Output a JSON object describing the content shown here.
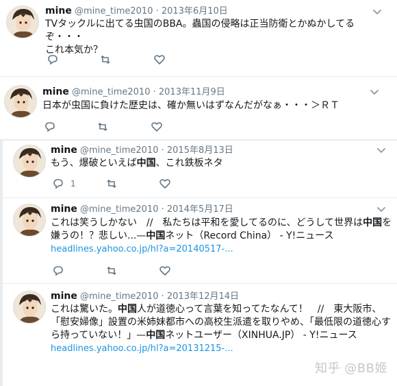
{
  "tweets": [
    {
      "name": "mine",
      "handle": "@mine_time2010",
      "date": "2013年6月10日",
      "text_line1": "TVタックルに出てる虫国のBBA。蟲国の侵略は正当防衛とかぬかしてるぞ・・・",
      "text_line2": "これ本気か？",
      "reply_count": "",
      "retweet_count": "",
      "like_count": ""
    },
    {
      "name": "mine",
      "handle": "@mine_time2010",
      "date": "2013年11月9日",
      "text_line1": "日本が虫国に負けた歴史は、確か無いはずなんだがなぁ・・・＞ＲＴ",
      "reply_count": "",
      "retweet_count": "",
      "like_count": ""
    },
    {
      "name": "mine",
      "handle": "@mine_time2010",
      "date": "2015年8月13日",
      "text_pre": "もう、爆破といえば",
      "text_bold": "中国",
      "text_post": "、これ鉄板ネタ",
      "reply_count": "1",
      "retweet_count": "",
      "like_count": ""
    },
    {
      "name": "mine",
      "handle": "@mine_time2010",
      "date": "2014年5月17日",
      "l1_a": "これは笑うしかない　//　私たちは平和を愛してるのに、どうして世界は",
      "l1_b": "中国",
      "l1_c": "を",
      "l2_a": "嫌うの！？悲しい...—",
      "l2_b": "中国",
      "l2_c": "ネット（Record China） - Y!ニュース",
      "link": "headlines.yahoo.co.jp/hl?a=20140517-...",
      "reply_count": "",
      "retweet_count": "",
      "like_count": ""
    },
    {
      "name": "mine",
      "handle": "@mine_time2010",
      "date": "2013年12月14日",
      "l1_a": "これは驚いた。",
      "l1_b": "中国",
      "l1_c": "人が道徳心って言葉を知ってたなんて！　//　東大阪市、",
      "l2": "「慰安婦像」設置の米姉妹都市への高校生派遣を取りやめ、「最低限の道徳心す",
      "l3_a": "ら持っていない！」—",
      "l3_b": "中国",
      "l3_c": "ネットユーザー（XINHUA.JP） - Y!ニュース",
      "link": "headlines.yahoo.co.jp/hl?a=20131215-...",
      "reply_count": "",
      "retweet_count": "",
      "like_count": ""
    }
  ],
  "icons": {
    "reply": "reply-icon",
    "retweet": "retweet-icon",
    "like": "heart-icon",
    "more": "chevron-down-icon"
  },
  "colors": {
    "link": "#1b95e0",
    "meta": "#657786",
    "icon": "#657786",
    "divider": "#e6ecf0"
  },
  "watermark": "知乎 @BB姬"
}
